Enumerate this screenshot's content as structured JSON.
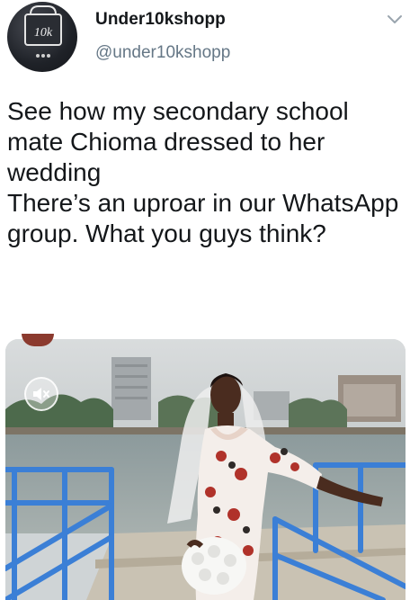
{
  "tweet": {
    "author": {
      "display_name": "Under10kshopp",
      "handle": "@under10kshopp",
      "avatar_icon": "logo-avatar"
    },
    "text": "See how my secondary school mate Chioma dressed to her wedding\nThere’s an uproar in our WhatsApp group. What you guys think?",
    "menu_icon": "chevron-down-icon",
    "media": {
      "type": "video",
      "mute_icon": "muted-speaker-icon"
    }
  },
  "colors": {
    "text": "#14171a",
    "secondary": "#657786",
    "railing": "#3b7fd6"
  }
}
